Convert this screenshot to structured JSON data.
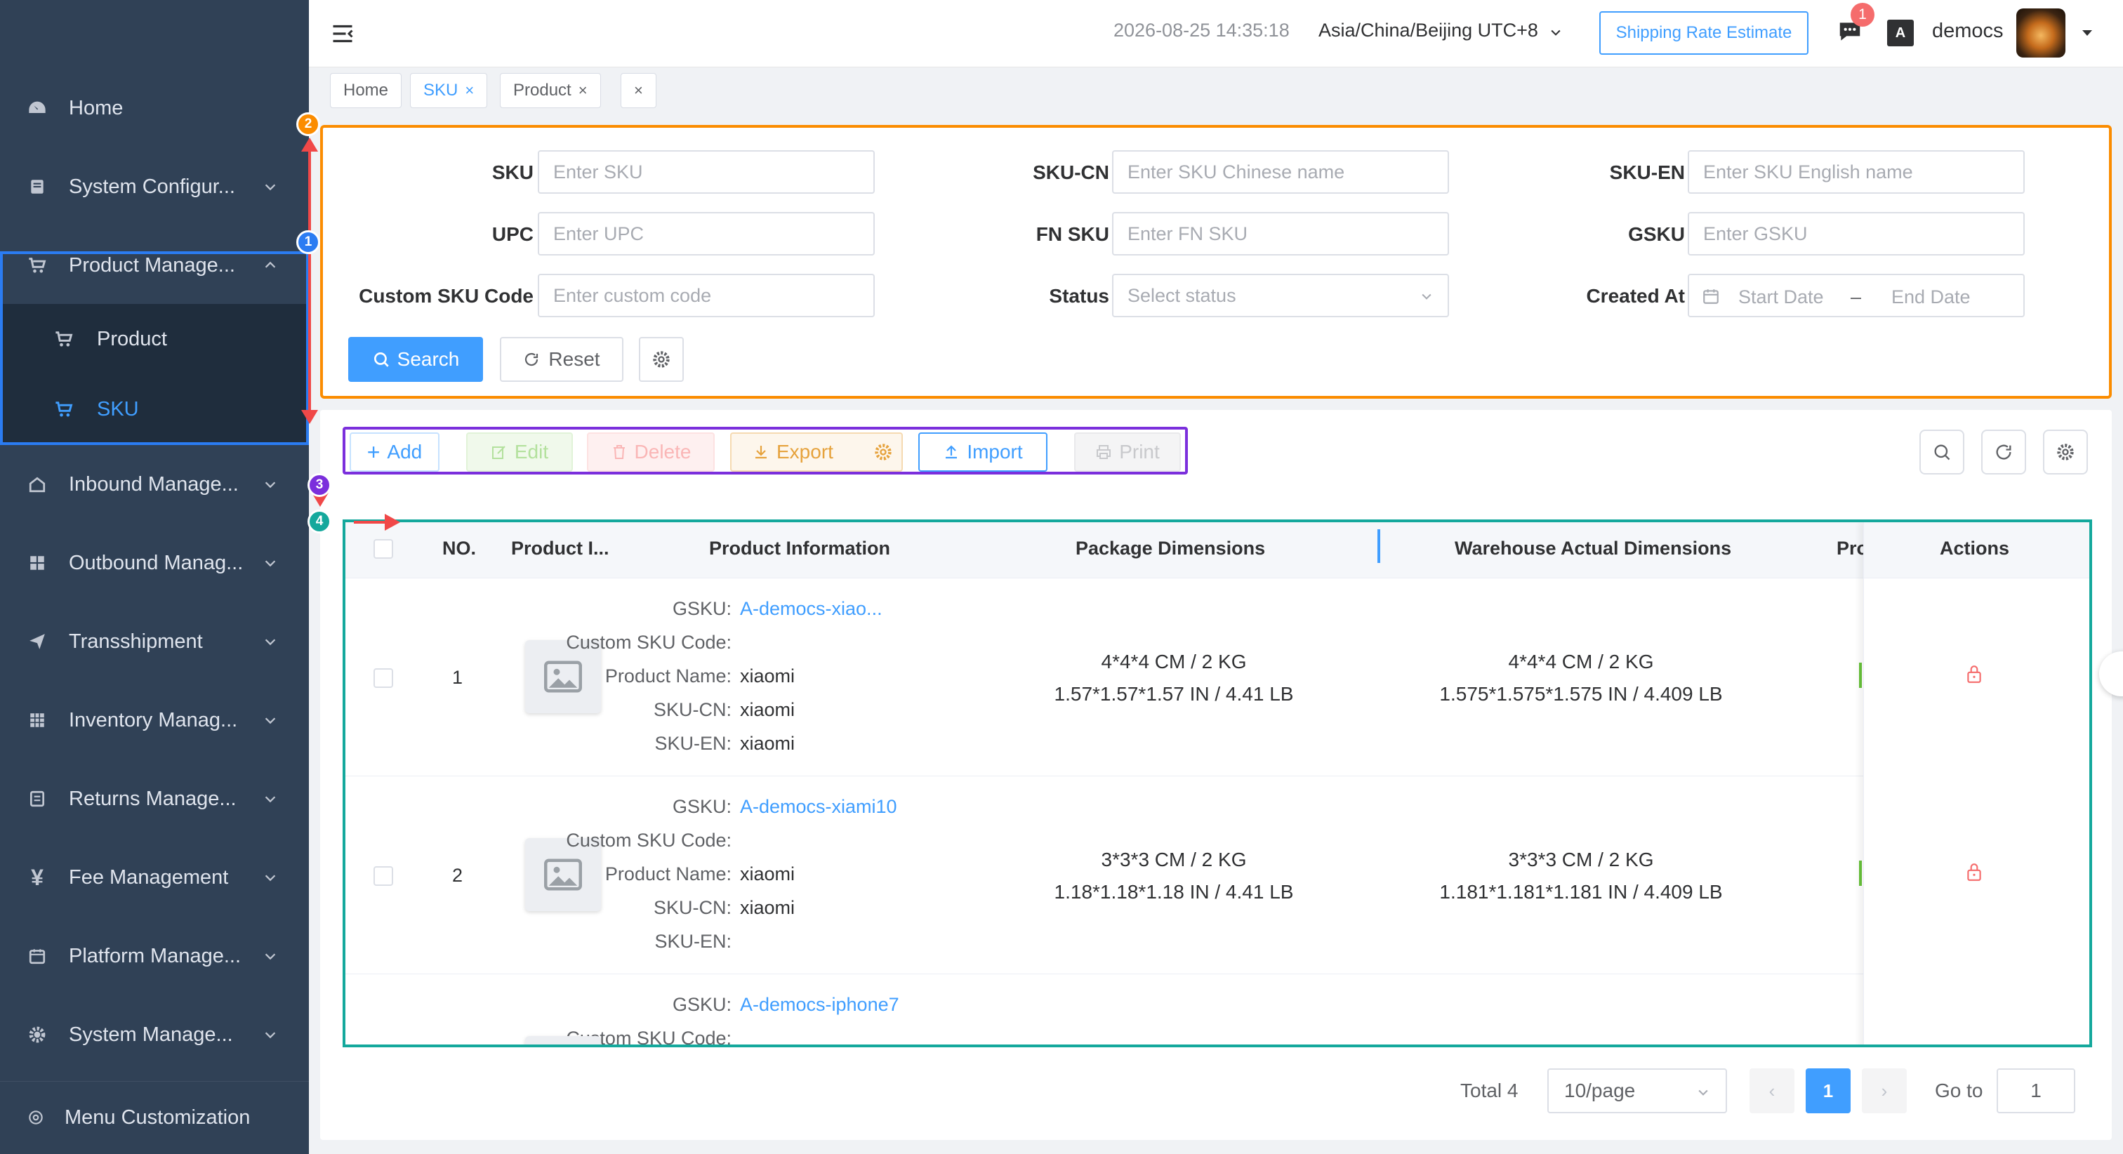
{
  "sidebar": {
    "items": [
      {
        "label": "Home"
      },
      {
        "label": "System Configur..."
      },
      {
        "label": "Product Manage..."
      },
      {
        "label": "Product"
      },
      {
        "label": "SKU"
      },
      {
        "label": "Inbound Manage..."
      },
      {
        "label": "Outbound Manag..."
      },
      {
        "label": "Transshipment"
      },
      {
        "label": "Inventory Manag..."
      },
      {
        "label": "Returns Manage..."
      },
      {
        "label": "Fee Management"
      },
      {
        "label": "Platform Manage..."
      },
      {
        "label": "System Manage..."
      }
    ],
    "customization": "Menu Customization"
  },
  "header": {
    "datetime": "2026-08-25 14:35:18",
    "timezone": "Asia/China/Beijing UTC+8",
    "shipping_button": "Shipping Rate Estimate",
    "message_badge": "1",
    "lang_icon_text": "A",
    "username": "democs"
  },
  "tags": [
    {
      "label": "Home"
    },
    {
      "label": "SKU"
    },
    {
      "label": "Product"
    }
  ],
  "search": {
    "sku_label": "SKU",
    "sku_placeholder": "Enter SKU",
    "skucn_label": "SKU-CN",
    "skucn_placeholder": "Enter SKU Chinese name",
    "skuen_label": "SKU-EN",
    "skuen_placeholder": "Enter SKU English name",
    "upc_label": "UPC",
    "upc_placeholder": "Enter UPC",
    "fnsku_label": "FN SKU",
    "fnsku_placeholder": "Enter FN SKU",
    "gsku_label": "GSKU",
    "gsku_placeholder": "Enter GSKU",
    "custom_label": "Custom SKU Code",
    "custom_placeholder": "Enter custom code",
    "status_label": "Status",
    "status_placeholder": "Select status",
    "created_label": "Created At",
    "start_date": "Start Date",
    "end_date": "End Date",
    "date_sep": "–",
    "search_button": "Search",
    "reset_button": "Reset"
  },
  "toolbar": {
    "add": "Add",
    "edit": "Edit",
    "delete": "Delete",
    "export": "Export",
    "import": "Import",
    "print": "Print"
  },
  "table": {
    "headers": {
      "no": "NO.",
      "image": "Product I...",
      "info": "Product Information",
      "package": "Package Dimensions",
      "warehouse": "Warehouse Actual Dimensions",
      "pro": "Pro",
      "actions": "Actions"
    },
    "field_labels": {
      "gsku": "GSKU:",
      "custom": "Custom SKU Code:",
      "name": "Product Name:",
      "skucn": "SKU-CN:",
      "skuen": "SKU-EN:"
    },
    "rows": [
      {
        "no": "1",
        "gsku": "A-democs-xiao...",
        "custom": "",
        "name": "xiaomi",
        "skucn": "xiaomi",
        "skuen": "xiaomi",
        "pkg_metric": "4*4*4 CM / 2 KG",
        "pkg_imperial": "1.57*1.57*1.57 IN / 4.41 LB",
        "wh_metric": "4*4*4 CM / 2 KG",
        "wh_imperial": "1.575*1.575*1.575 IN / 4.409 LB"
      },
      {
        "no": "2",
        "gsku": "A-democs-xiami10",
        "custom": "",
        "name": "xiaomi",
        "skucn": "xiaomi",
        "skuen": "",
        "pkg_metric": "3*3*3 CM / 2 KG",
        "pkg_imperial": "1.18*1.18*1.18 IN / 4.41 LB",
        "wh_metric": "3*3*3 CM / 2 KG",
        "wh_imperial": "1.181*1.181*1.181 IN / 4.409 LB"
      },
      {
        "no": "",
        "gsku": "A-democs-iphone7",
        "custom": ""
      }
    ]
  },
  "pagination": {
    "total": "Total 4",
    "page_size": "10/page",
    "current": "1",
    "goto_label": "Go to",
    "goto_value": "1",
    "prev": "‹",
    "next": "›"
  },
  "annotations": {
    "markers": [
      "1",
      "2",
      "3",
      "4"
    ],
    "colors": {
      "m1": "#2b7cf2",
      "m2": "#fb8c00",
      "m3": "#7b2fdc",
      "m4": "#14a89c"
    }
  },
  "colors": {
    "sidebar_bg": "#304156",
    "primary": "#409eff",
    "search_outline": "#fb8c00",
    "toolbar_outline": "#7b2fdc",
    "table_outline": "#14a89c"
  }
}
